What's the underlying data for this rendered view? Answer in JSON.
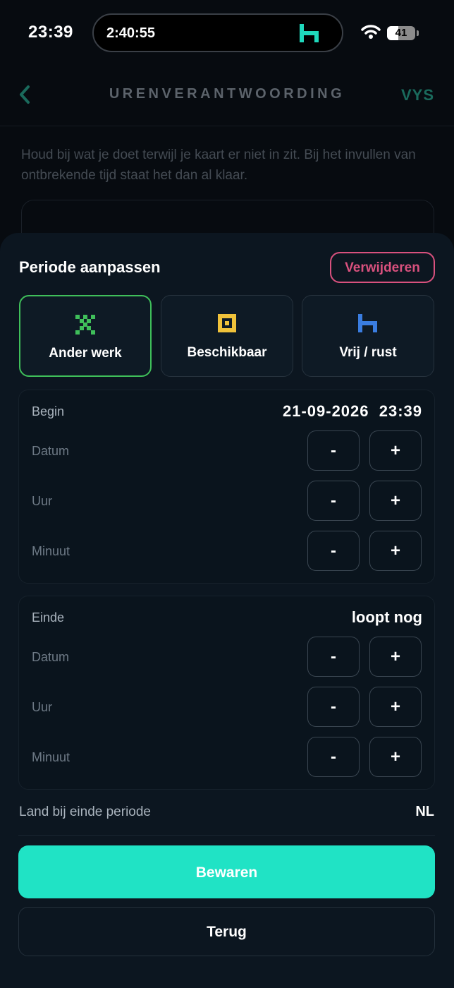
{
  "status_bar": {
    "time": "23:39",
    "live_activity_timer": "2:40:55",
    "battery": "41",
    "battery_level": 0.41
  },
  "header": {
    "title": "URENVERANTWOORDING",
    "brand": "VYS"
  },
  "intro_text": "Houd bij wat je doet terwijl je kaart er niet in zit. Bij het invullen van ontbrekende tijd staat het dan al klaar.",
  "sheet": {
    "title": "Periode aanpassen",
    "delete_label": "Verwijderen",
    "types": [
      {
        "label": "Ander werk",
        "icon": "other-work-icon",
        "color": "#3fbf5a",
        "selected": true
      },
      {
        "label": "Beschikbaar",
        "icon": "available-icon",
        "color": "#f0c23a",
        "selected": false
      },
      {
        "label": "Vrij / rust",
        "icon": "rest-icon",
        "color": "#3a7de0",
        "selected": false
      }
    ],
    "begin": {
      "label": "Begin",
      "value": "21-09-2026  23:39",
      "rows": [
        "Datum",
        "Uur",
        "Minuut"
      ]
    },
    "end": {
      "label": "Einde",
      "value": "loopt nog",
      "rows": [
        "Datum",
        "Uur",
        "Minuut"
      ]
    },
    "minus": "-",
    "plus": "+",
    "country_label": "Land bij einde periode",
    "country_value": "NL",
    "save_label": "Bewaren",
    "back_label": "Terug"
  },
  "colors": {
    "accent": "#20e3c5",
    "danger": "#d9517e",
    "selected_border": "#3fbf5a"
  }
}
